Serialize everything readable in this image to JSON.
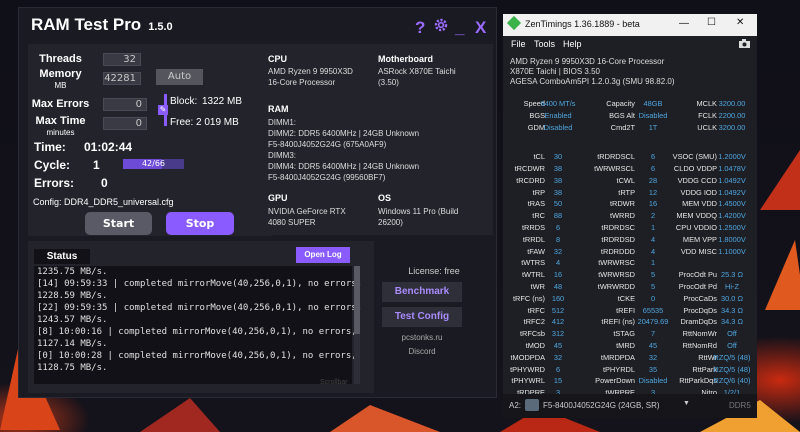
{
  "ramtest": {
    "title": "RAM Test Pro",
    "version": "1.5.0",
    "titlebar_icons": {
      "help": "?",
      "settings": "gear-icon",
      "minimize": "_",
      "close": "X"
    },
    "threads_label": "Threads",
    "threads_value": "32",
    "memory_label": "Memory",
    "memory_unit": "MB",
    "memory_value": "42281",
    "auto_label": "Auto",
    "max_errors_label": "Max Errors",
    "max_errors_value": "0",
    "max_time_label": "Max Time",
    "max_time_unit": "minutes",
    "max_time_value": "0",
    "block_label": "Block:",
    "block_value": "1322 MB",
    "free_label": "Free:",
    "free_value": "2 019 MB",
    "time_label": "Time:",
    "time_value": "01:02:44",
    "cycle_label": "Cycle:",
    "cycle_value": "1",
    "cycle_progress": "42/66",
    "cycle_fraction": 0.636,
    "errors_label": "Errors:",
    "errors_value": "0",
    "config_text": "Config: DDR4_DDR5_universal.cfg",
    "start_label": "Start",
    "stop_label": "Stop",
    "cpu_heading": "CPU",
    "cpu_value": [
      "AMD Ryzen 9 9950X3D",
      "16-Core Processor"
    ],
    "motherboard_heading": "Motherboard",
    "motherboard_value": [
      "ASRock X870E Taichi",
      "(3.50)"
    ],
    "ram_heading": "RAM",
    "ram_value": [
      "DIMM1:",
      "DIMM2: DDR5 6400MHz | 24GB Unknown",
      "F5-8400J4052G24G (675A0AF9)",
      "DIMM3:",
      "DIMM4: DDR5 6400MHz | 24GB Unknown",
      "F5-8400J4052G24G (99560BF7)"
    ],
    "gpu_heading": "GPU",
    "gpu_value": [
      "NVIDIA GeForce RTX",
      "4080 SUPER"
    ],
    "os_heading": "OS",
    "os_value": [
      "Windows 11 Pro (Build",
      "26200)"
    ],
    "status_label": "Status",
    "open_log_label": "Open Log",
    "log_lines": [
      "1235.75 MB/s.",
      "[14] 09:59:33 | completed mirrorMove(40,256,0,1), no errors,",
      "1228.59 MB/s.",
      "[22] 09:59:35 | completed mirrorMove(40,256,0,1), no errors,",
      "1243.57 MB/s.",
      "[8] 10:00:16 | completed mirrorMove(40,256,0,1), no errors,",
      "1127.14 MB/s.",
      "[0] 10:00:28 | completed mirrorMove(40,256,0,1), no errors,",
      "1128.75 MB/s."
    ],
    "scrollbar_label": "Scrollbar",
    "license_text": "License: free",
    "benchmark_label": "Benchmark",
    "test_config_label": "Test Config",
    "site_text": "pcstonks.ru",
    "discord_text": "Discord"
  },
  "zentimings": {
    "title": "ZenTimings 1.36.1889 - beta",
    "menu": [
      "File",
      "Tools",
      "Help"
    ],
    "sys_lines": [
      "AMD Ryzen 9 9950X3D 16-Core Processor",
      "X870E Taichi | BIOS 3.50",
      "AGESA ComboAm5PI 1.2.0.3g (SMU 98.82.0)"
    ],
    "rows": [
      [
        "Speed",
        "6400 MT/s",
        "Capacity",
        "48GB",
        "MCLK",
        "3200.00"
      ],
      [
        "BGS",
        "Enabled",
        "BGS Alt",
        "Disabled",
        "FCLK",
        "2200.00"
      ],
      [
        "GDM",
        "Disabled",
        "Cmd2T",
        "1T",
        "UCLK",
        "3200.00"
      ],
      [
        "",
        "",
        "",
        "",
        "",
        ""
      ],
      [
        "tCL",
        "30",
        "tRDRDSCL",
        "6",
        "VSOC (SMU)",
        "1.2000V"
      ],
      [
        "tRCDWR",
        "38",
        "tWRWRSCL",
        "6",
        "CLDO VDDP",
        "1.0478V"
      ],
      [
        "tRCDRD",
        "38",
        "tCWL",
        "28",
        "VDDG CCD",
        "1.0492V"
      ],
      [
        "tRP",
        "38",
        "tRTP",
        "12",
        "VDDG IOD",
        "1.0492V"
      ],
      [
        "tRAS",
        "50",
        "tRDWR",
        "16",
        "MEM VDD",
        "1.4500V"
      ],
      [
        "tRC",
        "88",
        "tWRRD",
        "2",
        "MEM VDDQ",
        "1.4200V"
      ],
      [
        "tRRDS",
        "6",
        "tRDRDSC",
        "1",
        "CPU VDDIO",
        "1.2500V"
      ],
      [
        "tRRDL",
        "8",
        "tRDRDSD",
        "4",
        "MEM VPP",
        "1.8000V"
      ],
      [
        "tFAW",
        "32",
        "tRDRDDD",
        "4",
        "VDD MISC",
        "1.1000V"
      ],
      [
        "tWTRS",
        "4",
        "tWRWRSC",
        "1",
        "",
        ""
      ],
      [
        "tWTRL",
        "16",
        "tWRWRSD",
        "5",
        "ProcOdt Pu",
        "25.3 Ω"
      ],
      [
        "tWR",
        "48",
        "tWRWRDD",
        "5",
        "ProcOdt Pd",
        "Hi-Z"
      ],
      [
        "tRFC (ns)",
        "160",
        "tCKE",
        "0",
        "ProcCaDs",
        "30.0 Ω"
      ],
      [
        "tRFC",
        "512",
        "tREFI",
        "65535",
        "ProcDqDs",
        "34.3 Ω"
      ],
      [
        "tRFC2",
        "412",
        "tREFI (ns)",
        "20479.69",
        "DramDqDs",
        "34.3 Ω"
      ],
      [
        "tRFCsb",
        "312",
        "tSTAG",
        "7",
        "RttNomWr",
        "Off"
      ],
      [
        "tMOD",
        "45",
        "tMRD",
        "45",
        "RttNomRd",
        "Off"
      ],
      [
        "tMODPDA",
        "32",
        "tMRDPDA",
        "32",
        "RttWr",
        "RZQ/5 (48)"
      ],
      [
        "tPHYWRD",
        "6",
        "tPHYRDL",
        "35",
        "RttPark",
        "RZQ/5 (48)"
      ],
      [
        "tPHYWRL",
        "15",
        "PowerDown",
        "Disabled",
        "RttParkDqs",
        "RZQ/6 (40)"
      ],
      [
        "tRDPRE",
        "3",
        "tWRPRE",
        "3",
        "Nitro",
        "1/2/1"
      ]
    ],
    "footer_slot": "A2:",
    "footer_module": "F5-8400J4052G24G (24GB, SR)",
    "footer_type": "DDR5"
  }
}
